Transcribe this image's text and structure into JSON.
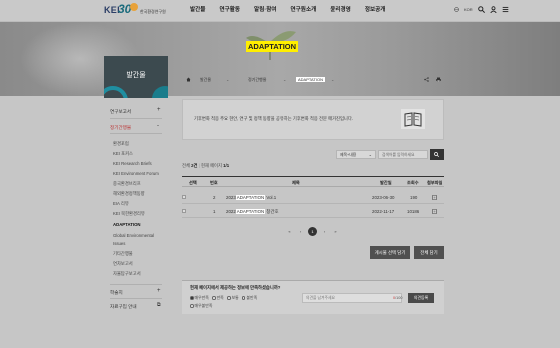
{
  "header": {
    "logo_text": "KEI",
    "logo_anniv": "30",
    "logo_sub": "한국환경연구원",
    "nav": [
      "발간물",
      "연구활동",
      "알림·참여",
      "연구원소개",
      "윤리경영",
      "정보공개"
    ],
    "lang": "KOR"
  },
  "hero": {
    "title": "ADAPTATION"
  },
  "sidebar": {
    "title": "발간물",
    "top_items": [
      {
        "label": "연구보고서",
        "plus": "+"
      },
      {
        "label": "정기간행물",
        "plus": "-"
      }
    ],
    "sub_items": [
      "환경포럼",
      "KEI 포커스",
      "KEI Research Briefs",
      "KEI Environment Forum",
      "중국환경브리프",
      "해외환경정책동향",
      "EIA 리뷰",
      "KEI 북한환경리뷰",
      "ADAPTATION",
      "Global Environmental",
      "Issues",
      "기타간행물",
      "연차보고서",
      "자율탐구보고서"
    ],
    "bottom_items": [
      {
        "label": "학술지",
        "plus": "+"
      },
      {
        "label": "자료구입 안내",
        "plus": "⧉"
      }
    ]
  },
  "breadcrumb": {
    "items": [
      "발간물",
      "정기간행물",
      "ADAPTATION"
    ]
  },
  "intro": {
    "text": "기후변화 적응 주요 현안, 연구 및 정책 동향을 공유하는 기후변화 적응 전문 매거진입니다."
  },
  "search": {
    "select_value": "제목+내용",
    "placeholder": "검색어를 입력하세요"
  },
  "count": {
    "prefix": "전체",
    "total": "2건",
    "page_prefix": "현재 페이지",
    "page": "1/1"
  },
  "table": {
    "headers": [
      "선택",
      "번호",
      "제목",
      "발간일",
      "조회수",
      "첨부파일"
    ],
    "rows": [
      {
        "no": "2",
        "title_pre": "2023",
        "title_hl": "ADAPTATION",
        "title_post": " Vol.1",
        "date": "2023-06-30",
        "views": "190"
      },
      {
        "no": "1",
        "title_pre": "2022",
        "title_hl": "ADAPTATION",
        "title_post": " 창간호",
        "date": "2022-11-17",
        "views": "10186"
      }
    ]
  },
  "pagination": {
    "first": "«",
    "prev": "‹",
    "current": "1",
    "next": "›",
    "last": "»"
  },
  "buttons": {
    "download_selected": "게시물 선택 담기",
    "download_all": "전체 담기"
  },
  "survey": {
    "question": "현재 페이지에서 제공하는 정보에 만족하셨습니까?",
    "options": [
      "매우만족",
      "만족",
      "보통",
      "불만족"
    ],
    "option5": "매우불만족",
    "input_placeholder": "의견을 남겨주세요",
    "counter_current": "0",
    "counter_max": "/100",
    "submit": "의견등록"
  },
  "colors": {
    "accent": "#1a7d8c",
    "highlight": "#ffef00",
    "dark": "#333333"
  }
}
